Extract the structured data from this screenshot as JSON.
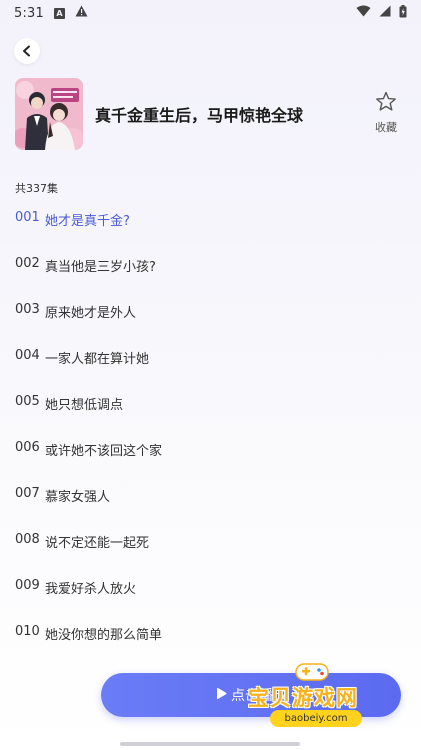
{
  "status_bar": {
    "time": "5:31",
    "icons": [
      "notification-a-icon",
      "warning-icon",
      "wifi-icon",
      "signal-icon",
      "battery-icon"
    ]
  },
  "drama": {
    "title": "真千金重生后，马甲惊艳全球",
    "cover_icon": "drama-cover-image",
    "favorite_label": "收藏",
    "episode_count": "共337集"
  },
  "episodes": [
    {
      "num": "001",
      "title": "她才是真千金?",
      "active": true
    },
    {
      "num": "002",
      "title": "真当他是三岁小孩?",
      "active": false
    },
    {
      "num": "003",
      "title": "原来她才是外人",
      "active": false
    },
    {
      "num": "004",
      "title": "一家人都在算计她",
      "active": false
    },
    {
      "num": "005",
      "title": "她只想低调点",
      "active": false
    },
    {
      "num": "006",
      "title": "或许她不该回这个家",
      "active": false
    },
    {
      "num": "007",
      "title": "慕家女强人",
      "active": false
    },
    {
      "num": "008",
      "title": "说不定还能一起死",
      "active": false
    },
    {
      "num": "009",
      "title": "我爱好杀人放火",
      "active": false
    },
    {
      "num": "010",
      "title": "她没你想的那么简单",
      "active": false
    }
  ],
  "play_button": {
    "label": "点击播放"
  },
  "watermark": {
    "brand": "宝贝游戏网",
    "url": "baobeiy.com"
  },
  "colors": {
    "accent": "#4a5bd8",
    "play_button": "#5b6af0",
    "watermark_yellow": "#f5b21a"
  }
}
